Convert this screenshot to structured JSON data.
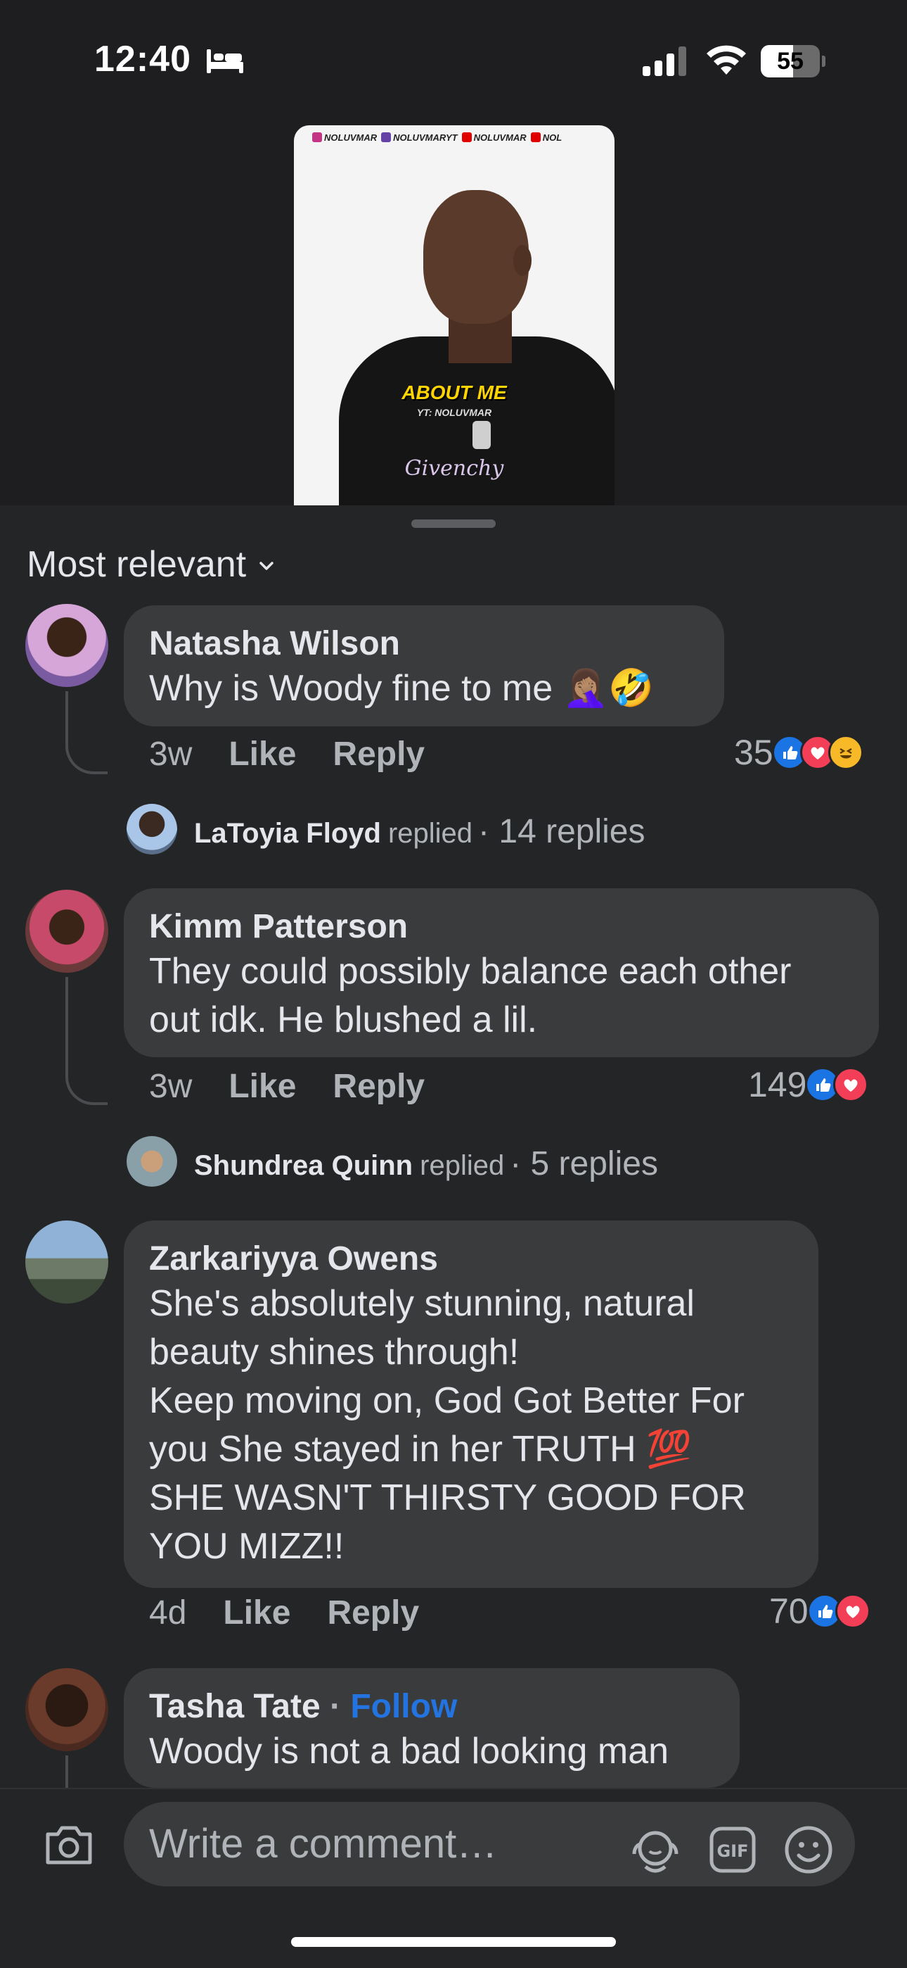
{
  "status_bar": {
    "time": "12:40",
    "battery_percent": 55,
    "battery_label": "55"
  },
  "video": {
    "handles": [
      "NOLUVMAR",
      "NOLUVMARYT",
      "NOLUVMAR",
      "NOL"
    ],
    "title": "ABOUT ME",
    "subtitle": "YT: NOLUVMAR",
    "shirt_text": "Givenchy"
  },
  "sort": {
    "label": "Most relevant"
  },
  "comments": [
    {
      "author": "Natasha Wilson",
      "text": "Why is Woody fine to me 🤦🏽‍♀️🤣",
      "time": "3w",
      "like_label": "Like",
      "reply_label": "Reply",
      "reaction_count": "35",
      "reactions": [
        "like",
        "love",
        "haha"
      ],
      "replied_by": "LaToyia Floyd",
      "replied_verb": "replied",
      "replies": "· 14 replies"
    },
    {
      "author": "Kimm Patterson",
      "text": "They could possibly balance each other out idk. He blushed a lil.",
      "time": "3w",
      "like_label": "Like",
      "reply_label": "Reply",
      "reaction_count": "149",
      "reactions": [
        "like",
        "love"
      ],
      "replied_by": "Shundrea Quinn",
      "replied_verb": "replied",
      "replies": "· 5 replies"
    },
    {
      "author": "Zarkariyya Owens",
      "text": "She's absolutely stunning, natural beauty shines through!\nKeep moving on, God Got Better For you She stayed in her TRUTH 💯\nSHE WASN'T THIRSTY GOOD FOR YOU MIZZ!!",
      "time": "4d",
      "like_label": "Like",
      "reply_label": "Reply",
      "reaction_count": "70",
      "reactions": [
        "like",
        "love"
      ]
    },
    {
      "author": "Tasha Tate",
      "follow_sep": "·",
      "follow_label": "Follow",
      "text": "Woody is not a bad looking man"
    }
  ],
  "composer": {
    "placeholder": "Write a comment…"
  },
  "colors": {
    "background": "#242526",
    "bubble": "#3a3b3c",
    "text_primary": "#e4e6eb",
    "text_secondary": "#b0b3b8",
    "follow_blue": "#2374e1",
    "like_blue": "#1b74e4",
    "love_red": "#f33e58",
    "haha_yellow": "#f7b928"
  },
  "icons": [
    "bed-icon",
    "signal-icon",
    "wifi-icon",
    "battery-icon",
    "chevron-down-icon",
    "like-reaction-icon",
    "love-reaction-icon",
    "haha-reaction-icon",
    "camera-icon",
    "avatar-sticker-icon",
    "gif-icon",
    "emoji-icon"
  ]
}
